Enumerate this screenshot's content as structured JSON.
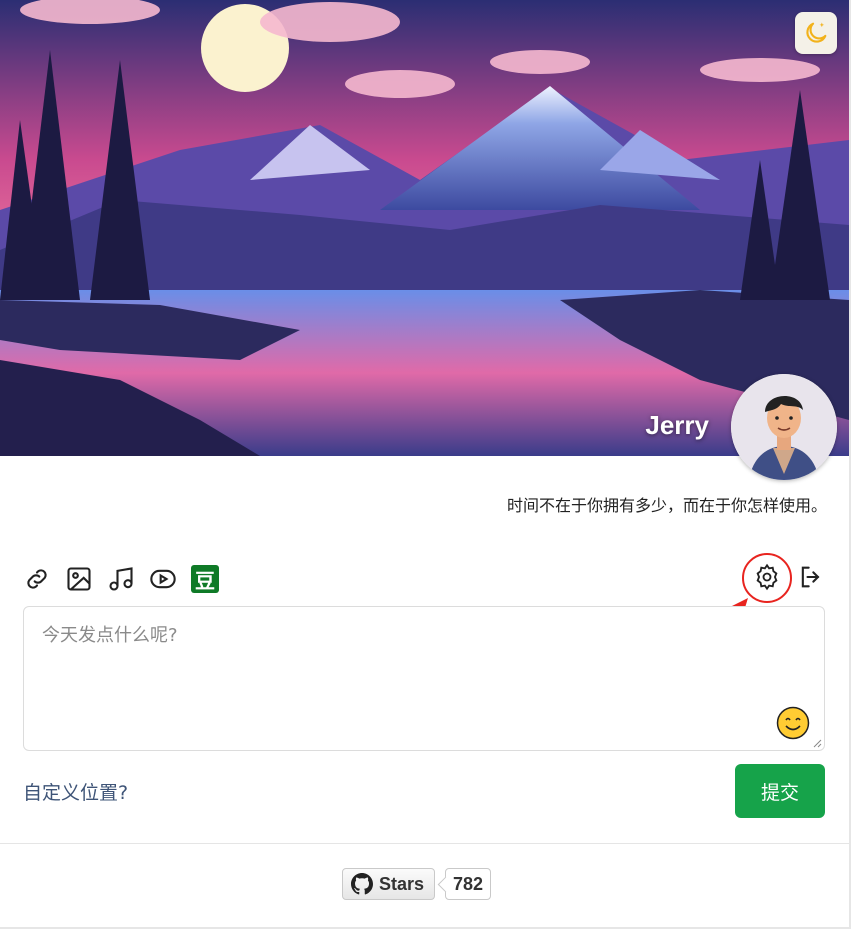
{
  "profile": {
    "username": "Jerry",
    "motto": "时间不在于你拥有多少，而在于你怎样使用。"
  },
  "toolbar": {
    "tools": [
      "link-icon",
      "image-icon",
      "music-icon",
      "video-icon",
      "douban-icon"
    ],
    "douban_label": "豆",
    "right_tools": [
      "settings-icon",
      "logout-icon"
    ]
  },
  "editor": {
    "placeholder": "今天发点什么呢?",
    "value": ""
  },
  "footer": {
    "location_link": "自定义位置?",
    "submit_label": "提交"
  },
  "github": {
    "stars_label": "Stars",
    "stars_count": "782"
  },
  "colors": {
    "submit": "#16a34a",
    "link": "#3e5477",
    "annotation": "#e8241f"
  }
}
